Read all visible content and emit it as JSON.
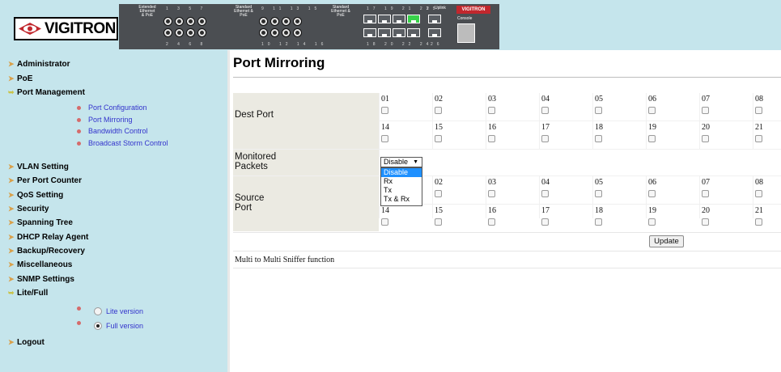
{
  "header": {
    "brand": "VIGITRON",
    "panel": {
      "group1_label": "Extended Ethernet & PoE",
      "group2_label": "Standard Ethernet & PoE",
      "group3_label": "Standard Ethernet & PoE",
      "group1_top_numbers": "1 3 5 7",
      "group1_bottom_numbers": "2 4 6 8",
      "group2_top_numbers": "9 11 13 15",
      "group2_bottom_numbers": "10 12 14 16",
      "group3_top_numbers": "17 19 21 23",
      "group3_bottom_numbers": "18 20 22 24",
      "uplink_top": "25",
      "uplink_bottom": "26",
      "uplink_label": "Uplink",
      "console_label": "Console",
      "panel_logo": "VIGITRON"
    }
  },
  "sidebar": {
    "items": [
      {
        "label": "Administrator"
      },
      {
        "label": "PoE"
      },
      {
        "label": "Port Management"
      },
      {
        "label": "VLAN Setting"
      },
      {
        "label": "Per Port Counter"
      },
      {
        "label": "QoS Setting"
      },
      {
        "label": "Security"
      },
      {
        "label": "Spanning Tree"
      },
      {
        "label": "DHCP Relay Agent"
      },
      {
        "label": "Backup/Recovery"
      },
      {
        "label": "Miscellaneous"
      },
      {
        "label": "SNMP Settings"
      },
      {
        "label": "Lite/Full"
      },
      {
        "label": "Logout"
      }
    ],
    "port_management_sub": [
      {
        "label": "Port Configuration"
      },
      {
        "label": "Port Mirroring"
      },
      {
        "label": "Bandwidth Control"
      },
      {
        "label": "Broadcast Storm Control"
      }
    ],
    "lite_full": {
      "lite_label": "Lite version",
      "full_label": "Full version",
      "selected": "Full version"
    }
  },
  "main": {
    "title": "Port Mirroring",
    "dest_label": "Dest Port",
    "monitored_label": "Monitored Packets",
    "source_label": "Source Port",
    "row1_ports": [
      "01",
      "02",
      "03",
      "04",
      "05",
      "06",
      "07",
      "08"
    ],
    "row2_ports": [
      "14",
      "15",
      "16",
      "17",
      "18",
      "19",
      "20",
      "21"
    ],
    "source_row1_ports": [
      "",
      "02",
      "03",
      "04",
      "05",
      "06",
      "07",
      "08"
    ],
    "monitored": {
      "value": "Disable",
      "options": [
        "Disable",
        "Rx",
        "Tx",
        "Tx & Rx"
      ]
    },
    "update_label": "Update",
    "sniffer_text": "Multi to Multi Sniffer function"
  }
}
